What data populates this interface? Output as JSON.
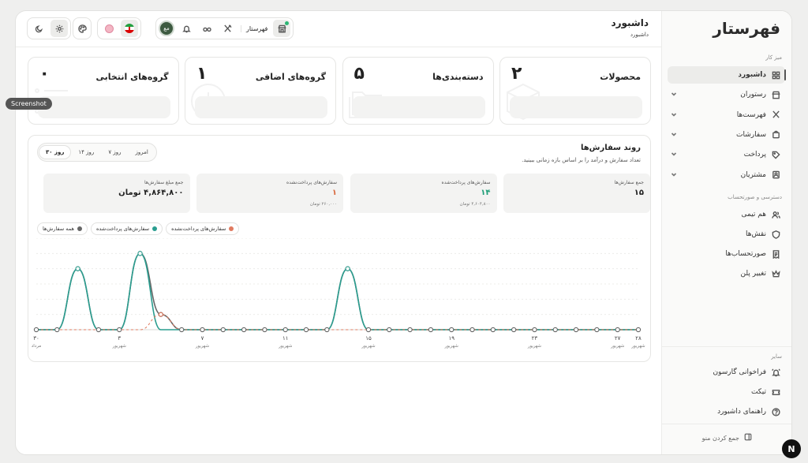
{
  "app": {
    "logo": "فهرستار",
    "screenshot_badge": "Screenshot",
    "n_badge": "N"
  },
  "sidebar": {
    "section_work": "میز کار",
    "items": [
      {
        "label": "داشبورد",
        "icon": "grid-icon",
        "active": true,
        "chevron": false
      },
      {
        "label": "رستوران",
        "icon": "store-icon",
        "active": false,
        "chevron": true
      },
      {
        "label": "فهرست‌ها",
        "icon": "utensils-icon",
        "active": false,
        "chevron": true
      },
      {
        "label": "سفارشات",
        "icon": "bag-icon",
        "active": false,
        "chevron": true
      },
      {
        "label": "پرداخت",
        "icon": "tag-icon",
        "active": false,
        "chevron": true
      },
      {
        "label": "مشتریان",
        "icon": "contact-icon",
        "active": false,
        "chevron": true
      }
    ],
    "section_access": "دسترسی و صورتحساب",
    "access_items": [
      {
        "label": "هم تیمی",
        "icon": "users-icon"
      },
      {
        "label": "نقش‌ها",
        "icon": "shield-icon"
      },
      {
        "label": "صورتحساب‌ها",
        "icon": "receipt-icon"
      },
      {
        "label": "تغییر پلن",
        "icon": "crown-icon"
      }
    ],
    "section_other": "سایر",
    "other_items": [
      {
        "label": "فراخوانی گارسون",
        "icon": "bell-ring-icon"
      },
      {
        "label": "تیکت",
        "icon": "ticket-icon"
      },
      {
        "label": "راهنمای داشبورد",
        "icon": "help-icon"
      }
    ],
    "collapse_label": "جمع کردن منو"
  },
  "header": {
    "title": "داشبورد",
    "breadcrumb": "داشبورد",
    "store_name": "فهرستار",
    "avatar_text": "مع"
  },
  "stats": [
    {
      "title": "محصولات",
      "value": "۲",
      "icon": "box-icon"
    },
    {
      "title": "دسته‌بندی‌ها",
      "value": "۵",
      "icon": "folders-icon"
    },
    {
      "title": "گروه‌های اضافی",
      "value": "۱",
      "icon": "plus-circle-icon"
    },
    {
      "title": "گروه‌های انتخابی",
      "value": "۰",
      "icon": "list-icon"
    }
  ],
  "orders": {
    "title": "روند سفارش‌ها",
    "subtitle": "تعداد سفارش و درآمد را بر اساس بازه زمانی ببینید.",
    "ranges": [
      "امروز",
      "۷ روز",
      "۱۴ روز",
      "۳۰ روز"
    ],
    "active_range": "۳۰ روز",
    "summary": [
      {
        "label": "جمع سفارش‌ها",
        "value": "۱۵",
        "sub": "",
        "color": "#222222"
      },
      {
        "label": "سفارش‌های پرداخت‌شده",
        "value": "۱۴",
        "sub": "۴,۶۰۴,۸۰۰ تومان",
        "color": "#1f9e78"
      },
      {
        "label": "سفارش‌های پرداخت‌نشده",
        "value": "۱",
        "sub": "۲۶۰,۰۰۰ تومان",
        "color": "#d9693e"
      },
      {
        "label": "جمع مبلغ سفارش‌ها",
        "value": "۴,۸۶۴,۸۰۰ تومان",
        "sub": "",
        "color": "#222222"
      }
    ],
    "legend": [
      {
        "label": "سفارش‌های پرداخت‌نشده",
        "color": "#e07a5f"
      },
      {
        "label": "سفارش‌های پرداخت‌شده",
        "color": "#2a9d8f"
      },
      {
        "label": "همه سفارش‌ها",
        "color": "#666666"
      }
    ]
  },
  "chart_data": {
    "type": "line",
    "x": [
      "۳۰ مرداد",
      "۳۱ مرداد",
      "۱ شهریور",
      "۲ شهریور",
      "۳ شهریور",
      "۴ شهریور",
      "۵ شهریور",
      "۶ شهریور",
      "۷ شهریور",
      "۸ شهریور",
      "۹ شهریور",
      "۱۰ شهریور",
      "۱۱ شهریور",
      "۱۲ شهریور",
      "۱۳ شهریور",
      "۱۴ شهریور",
      "۱۵ شهریور",
      "۱۶ شهریور",
      "۱۷ شهریور",
      "۱۸ شهریور",
      "۱۹ شهریور",
      "۲۰ شهریور",
      "۲۱ شهریور",
      "۲۲ شهریور",
      "۲۳ شهریور",
      "۲۴ شهریور",
      "۲۵ شهریور",
      "۲۶ شهریور",
      "۲۷ شهریور",
      "۲۸ شهریور"
    ],
    "tick_labels": [
      {
        "index": 0,
        "day": "۳۰",
        "month": "مرداد"
      },
      {
        "index": 4,
        "day": "۳",
        "month": "شهریور"
      },
      {
        "index": 8,
        "day": "۷",
        "month": "شهریور"
      },
      {
        "index": 12,
        "day": "۱۱",
        "month": "شهریور"
      },
      {
        "index": 16,
        "day": "۱۵",
        "month": "شهریور"
      },
      {
        "index": 20,
        "day": "۱۹",
        "month": "شهریور"
      },
      {
        "index": 24,
        "day": "۲۳",
        "month": "شهریور"
      },
      {
        "index": 28,
        "day": "۲۷",
        "month": "شهریور"
      },
      {
        "index": 29,
        "day": "۲۸",
        "month": "شهریور"
      }
    ],
    "ylim": [
      0,
      6
    ],
    "grid": true,
    "series": [
      {
        "name": "همه سفارش‌ها",
        "color": "#666666",
        "values": [
          0,
          0,
          4,
          0,
          0,
          5,
          1,
          0,
          0,
          0,
          0,
          0,
          0,
          0,
          0,
          4,
          0,
          0,
          0,
          0,
          0,
          0,
          0,
          0,
          0,
          0,
          0,
          0,
          0,
          0
        ]
      },
      {
        "name": "سفارش‌های پرداخت‌شده",
        "color": "#2a9d8f",
        "values": [
          0,
          0,
          4,
          0,
          0,
          5,
          0,
          0,
          0,
          0,
          0,
          0,
          0,
          0,
          0,
          4,
          0,
          0,
          0,
          0,
          0,
          0,
          0,
          0,
          0,
          0,
          0,
          0,
          0,
          0
        ]
      },
      {
        "name": "سفارش‌های پرداخت‌نشده",
        "color": "#e07a5f",
        "values": [
          0,
          0,
          0,
          0,
          0,
          0,
          1,
          0,
          0,
          0,
          0,
          0,
          0,
          0,
          0,
          0,
          0,
          0,
          0,
          0,
          0,
          0,
          0,
          0,
          0,
          0,
          0,
          0,
          0,
          0
        ]
      }
    ]
  }
}
